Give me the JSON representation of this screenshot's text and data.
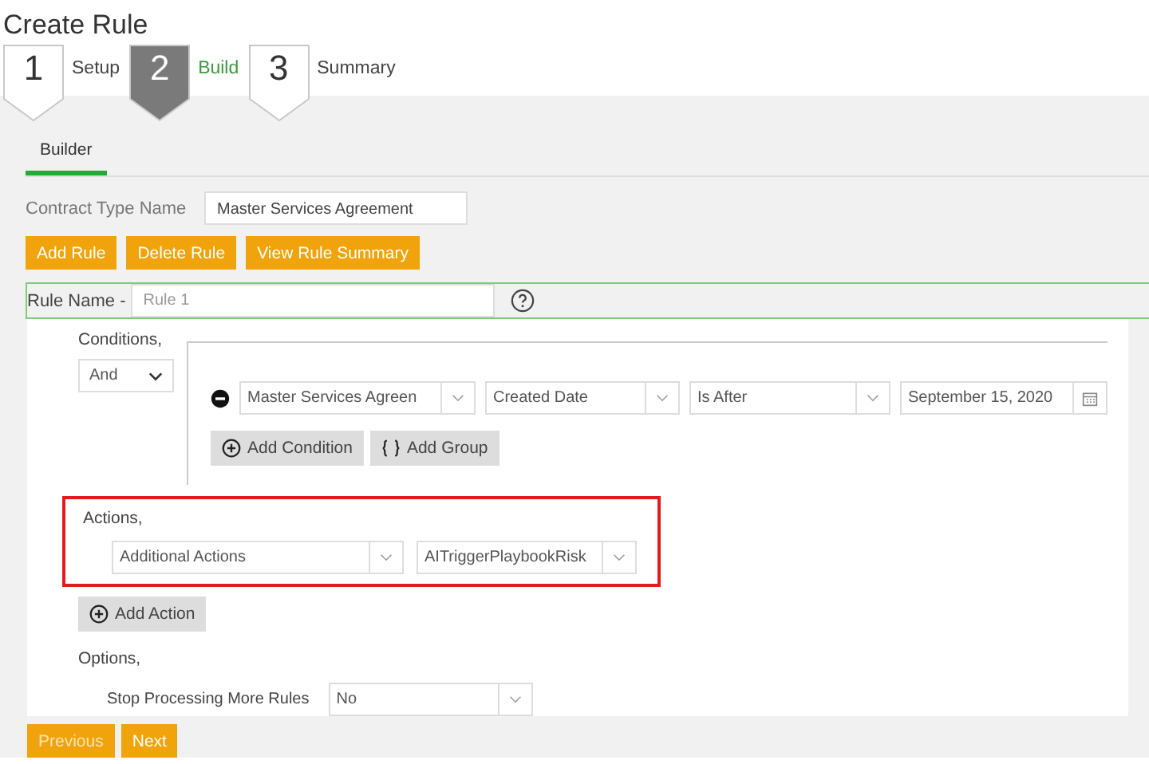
{
  "title": "Create Rule",
  "steps": [
    {
      "number": "1",
      "label": "Setup",
      "selected": false
    },
    {
      "number": "2",
      "label": "Build",
      "selected": true
    },
    {
      "number": "3",
      "label": "Summary",
      "selected": false
    }
  ],
  "tabs": [
    {
      "label": "Builder",
      "selected": true
    }
  ],
  "contract_type": {
    "label": "Contract Type Name",
    "value": "Master Services Agreement"
  },
  "toolbar_buttons": [
    "Add Rule",
    "Delete Rule",
    "View Rule Summary"
  ],
  "rule_name": {
    "label": "Rule Name -",
    "placeholder": "Rule 1"
  },
  "conditions": {
    "label": "Conditions,",
    "operator": "And",
    "rows": [
      {
        "fields": [
          "Master Services Agreen",
          "Created Date",
          "Is After"
        ],
        "date": "September 15, 2020"
      }
    ],
    "buttons": [
      {
        "kind": "add",
        "label": "Add Condition"
      },
      {
        "kind": "group",
        "label": "Add Group"
      }
    ]
  },
  "actions": {
    "label": "Actions,",
    "highlighted": true,
    "selects": [
      "Additional Actions",
      "AITriggerPlaybookRisk"
    ],
    "add_button": "Add Action"
  },
  "options": {
    "label": "Options,",
    "items": [
      {
        "label": "Stop Processing More Rules",
        "value": "No"
      }
    ]
  },
  "footer_buttons": [
    {
      "label": "Previous",
      "disabled": true
    },
    {
      "label": "Next",
      "disabled": false
    }
  ]
}
